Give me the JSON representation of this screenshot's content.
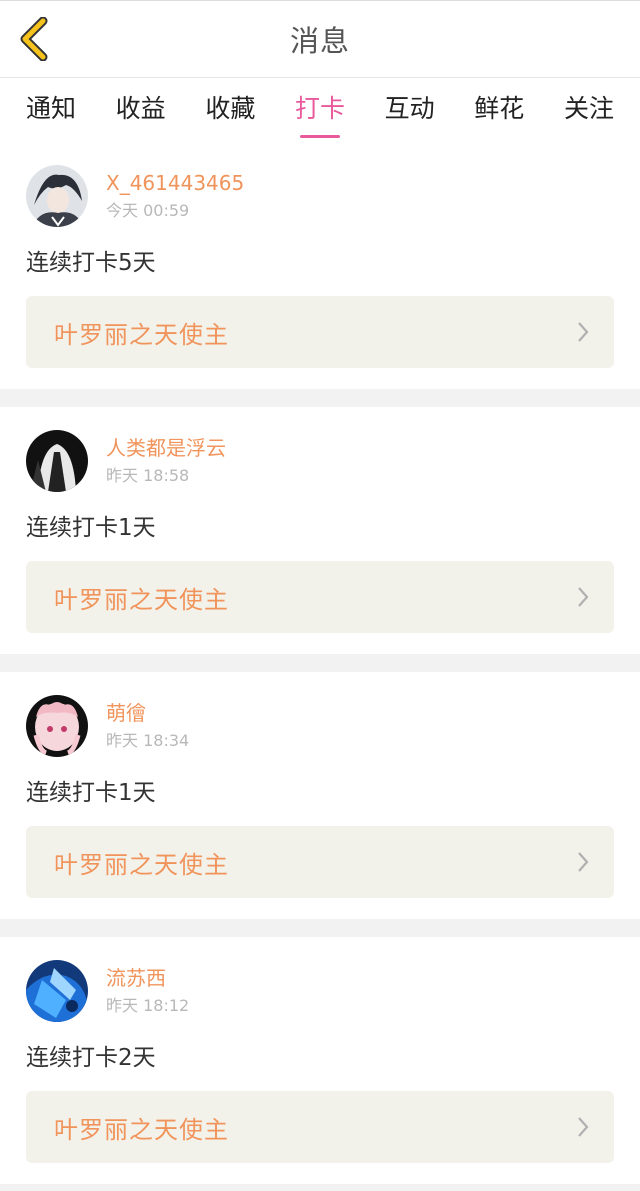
{
  "header": {
    "title": "消息"
  },
  "tabs": [
    {
      "label": "通知",
      "active": false
    },
    {
      "label": "收益",
      "active": false
    },
    {
      "label": "收藏",
      "active": false
    },
    {
      "label": "打卡",
      "active": true
    },
    {
      "label": "互动",
      "active": false
    },
    {
      "label": "鲜花",
      "active": false
    },
    {
      "label": "关注",
      "active": false
    }
  ],
  "feed": {
    "items": [
      {
        "username": "X_461443465",
        "time": "今天 00:59",
        "message": "连续打卡5天",
        "club": "叶罗丽之天使主"
      },
      {
        "username": "人类都是浮云",
        "time": "昨天 18:58",
        "message": "连续打卡1天",
        "club": "叶罗丽之天使主"
      },
      {
        "username": "萌徻",
        "time": "昨天 18:34",
        "message": "连续打卡1天",
        "club": "叶罗丽之天使主"
      },
      {
        "username": "流苏西",
        "time": "昨天 18:12",
        "message": "连续打卡2天",
        "club": "叶罗丽之天使主"
      }
    ]
  },
  "colors": {
    "accent_orange": "#f0945c",
    "tab_active": "#e85a9c",
    "back_arrow": "#f6c21c"
  }
}
